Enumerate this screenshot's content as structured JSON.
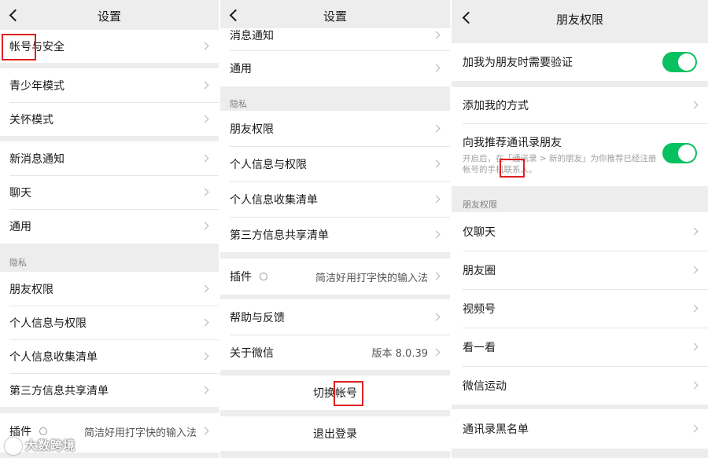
{
  "panel1": {
    "title": "设置",
    "groups": [
      [
        "帐号与安全"
      ],
      [
        "青少年模式",
        "关怀模式"
      ],
      [
        "新消息通知",
        "聊天",
        "通用"
      ]
    ],
    "privacy_label": "隐私",
    "privacy_items": [
      "朋友权限",
      "个人信息与权限",
      "个人信息收集清单",
      "第三方信息共享清单"
    ],
    "plugin_label": "插件",
    "plugin_value": "简洁好用打字快的输入法"
  },
  "panel2": {
    "title": "设置",
    "top_items": [
      "消息通知",
      "通用"
    ],
    "privacy_label": "隐私",
    "privacy_items": [
      "朋友权限",
      "个人信息与权限",
      "个人信息收集清单",
      "第三方信息共享清单"
    ],
    "plugin_label": "插件",
    "plugin_value": "简洁好用打字快的输入法",
    "help_label": "帮助与反馈",
    "about_label": "关于微信",
    "about_value": "版本 8.0.39",
    "switch_account": "切换帐号",
    "logout": "退出登录"
  },
  "panel3": {
    "title": "朋友权限",
    "verify_label": "加我为朋友时需要验证",
    "verify_on": true,
    "add_methods_label": "添加我的方式",
    "recommend_label": "向我推荐通讯录朋友",
    "recommend_on": true,
    "recommend_desc": "开启后，在「通讯录 > 新的朋友」为你推荐已经注册帐号的手机联系人。",
    "section_label": "朋友权限",
    "perm_items": [
      "仅聊天",
      "朋友圈",
      "视频号",
      "看一看",
      "微信运动"
    ],
    "blacklist_label": "通讯录黑名单"
  },
  "watermark": "大数跨境",
  "colors": {
    "accent_green": "#07c160",
    "highlight_red": "#e02020",
    "background": "#ededed"
  }
}
